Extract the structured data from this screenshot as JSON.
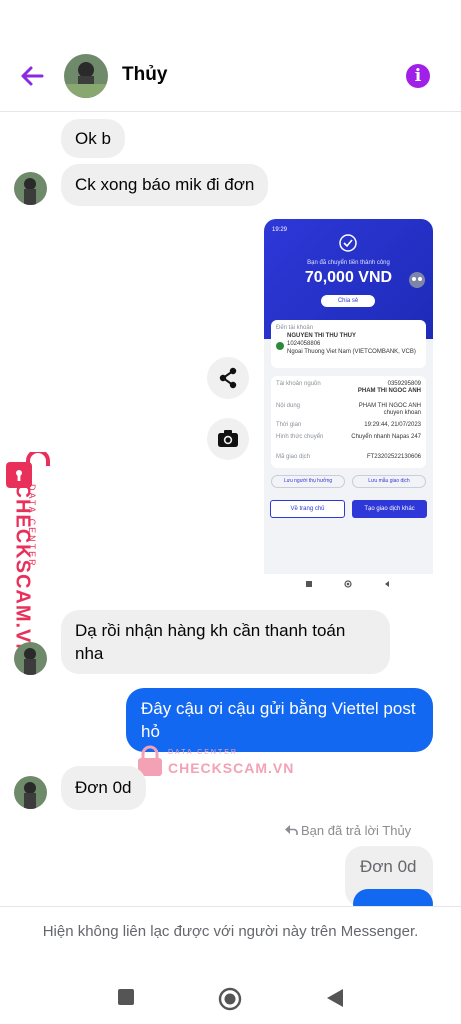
{
  "header": {
    "contact_name": "Thủy"
  },
  "messages": [
    {
      "id": "m1",
      "direction": "in",
      "text": "Ok b"
    },
    {
      "id": "m2",
      "direction": "in",
      "text": "Ck xong báo mik đi đơn"
    },
    {
      "id": "m3",
      "direction": "in",
      "text": "Dạ rồi nhận hàng kh cần thanh toán nha"
    },
    {
      "id": "m4",
      "direction": "out",
      "text": "Đây cậu ơi cậu gửi bằng Viettel post hỏ"
    },
    {
      "id": "m5",
      "direction": "in",
      "text": "Đơn 0d"
    },
    {
      "id": "m6",
      "direction": "out_reply",
      "text": "Đơn 0d"
    }
  ],
  "reply_note": "Bạn đã trả lời Thủy",
  "transfer_receipt": {
    "status_time": "19:29",
    "headline": "Bạn đã chuyển tiền thành công",
    "amount": "70,000 VND",
    "share_label": "Chia sẻ",
    "to_label": "Đến tài khoản",
    "recipient_name": "NGUYEN THI THU THUY",
    "recipient_account": "1024058806",
    "recipient_bank": "Ngoai Thuong Viet Nam (VIETCOMBANK, VCB)",
    "source_label": "Tài khoản nguồn",
    "source_account": "0359295809",
    "source_name": "PHAM THI NGOC ANH",
    "content_label": "Nội dung",
    "content_value": "PHAM THI NGOC ANH chuyen khoan",
    "time_label": "Thời gian",
    "time_value": "19:29:44, 21/07/2023",
    "method_label": "Hình thức chuyển",
    "method_value": "Chuyển nhanh Napas 247",
    "txn_label": "Mã giao dịch",
    "txn_value": "FT23202522130606",
    "save_beneficiary": "Lưu người thụ hưởng",
    "save_template": "Lưu mẫu giao dịch",
    "home_button": "Về trang chủ",
    "new_txn_button": "Tạo giao dịch khác"
  },
  "watermark": {
    "brand": "CHECKSCAM.VN",
    "tagline": "DATA CENTER",
    "color": "#e8305a"
  },
  "footer": {
    "notice": "Hiện không liên lạc được với người này trên Messenger."
  },
  "colors": {
    "accent": "#8a2be2",
    "outgoing": "#1368f2",
    "incoming": "#efefef"
  }
}
